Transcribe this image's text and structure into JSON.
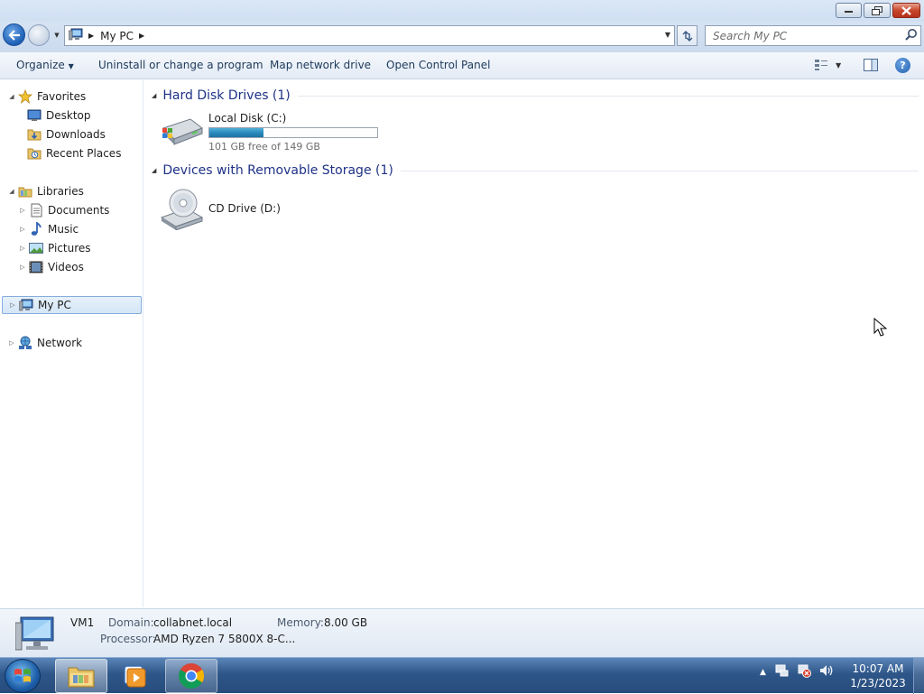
{
  "window": {
    "title_buttons": {
      "minimize": "minimize-icon",
      "maximize": "restore-icon",
      "close": "close-icon"
    }
  },
  "navbar": {
    "breadcrumb": [
      "My PC"
    ],
    "search_placeholder": "Search My PC"
  },
  "toolbar": {
    "organize_label": "Organize",
    "uninstall_label": "Uninstall or change a program",
    "map_label": "Map network drive",
    "control_label": "Open Control Panel"
  },
  "navpane": {
    "favorites": {
      "label": "Favorites",
      "items": [
        {
          "label": "Desktop"
        },
        {
          "label": "Downloads"
        },
        {
          "label": "Recent Places"
        }
      ]
    },
    "libraries": {
      "label": "Libraries",
      "items": [
        {
          "label": "Documents"
        },
        {
          "label": "Music"
        },
        {
          "label": "Pictures"
        },
        {
          "label": "Videos"
        }
      ]
    },
    "mypc": {
      "label": "My PC"
    },
    "network": {
      "label": "Network"
    }
  },
  "content": {
    "groups": [
      {
        "title": "Hard Disk Drives (1)"
      },
      {
        "title": "Devices with Removable Storage (1)"
      }
    ],
    "drives": [
      {
        "name": "Local Disk (C:)",
        "free_text": "101 GB free of 149 GB",
        "used_fraction": 0.322
      },
      {
        "name": "CD Drive (D:)"
      }
    ]
  },
  "details": {
    "computer_name": "VM1",
    "domain_label": "Domain:",
    "domain_value": "collabnet.local",
    "memory_label": "Memory:",
    "memory_value": "8.00 GB",
    "processor_label": "Processor:",
    "processor_value": "AMD Ryzen 7 5800X 8-C..."
  },
  "taskbar": {
    "time": "10:07 AM",
    "date": "1/23/2023",
    "pinned": [
      "folder-icon",
      "media-player-icon",
      "chrome-icon"
    ]
  },
  "colors": {
    "accent": "#1e3287",
    "link": "#1e395b",
    "disk_fill": "#2887ba"
  }
}
